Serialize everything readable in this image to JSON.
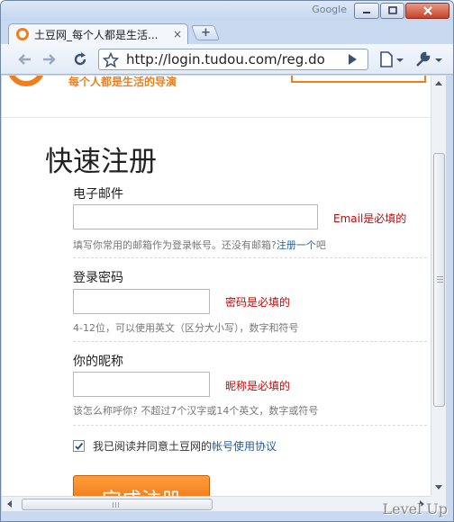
{
  "window": {
    "brand": "Google"
  },
  "tab": {
    "title": "土豆网_每个人都是生活...",
    "close_glyph": "×",
    "new_tab_glyph": "+"
  },
  "toolbar": {
    "url": "http://login.tudou.com/reg.do"
  },
  "header": {
    "slogan": "每个人都是生活的导演"
  },
  "form": {
    "title": "快速注册",
    "email": {
      "label": "电子邮件",
      "value": "",
      "error": "Email是必填的",
      "hint_prefix": "填写你常用的邮箱作为登录帐号。还没有邮箱?",
      "hint_link": "注册一个",
      "hint_suffix": "吧"
    },
    "password": {
      "label": "登录密码",
      "value": "",
      "error": "密码是必填的",
      "hint": "4-12位，可以使用英文（区分大小写），数字和符号"
    },
    "nickname": {
      "label": "你的昵称",
      "value": "",
      "error": "昵称是必填的",
      "hint": "该怎么称呼你? 不超过7个汉字或14个英文，数字或符号"
    },
    "agree": {
      "checked": true,
      "text": "我已阅读并同意土豆网的",
      "link": "帐号使用协议"
    },
    "submit_label": "完成注册"
  },
  "watermark": "Level Up",
  "icons": {
    "back": "back-arrow-icon",
    "forward": "forward-arrow-icon",
    "reload": "reload-icon",
    "star": "star-icon",
    "go": "go-arrow-icon",
    "page_menu": "page-menu-icon",
    "wrench": "wrench-icon"
  },
  "colors": {
    "brand_orange": "#f07e1b",
    "error_red": "#cc0000",
    "link_blue": "#1f5e9c"
  }
}
